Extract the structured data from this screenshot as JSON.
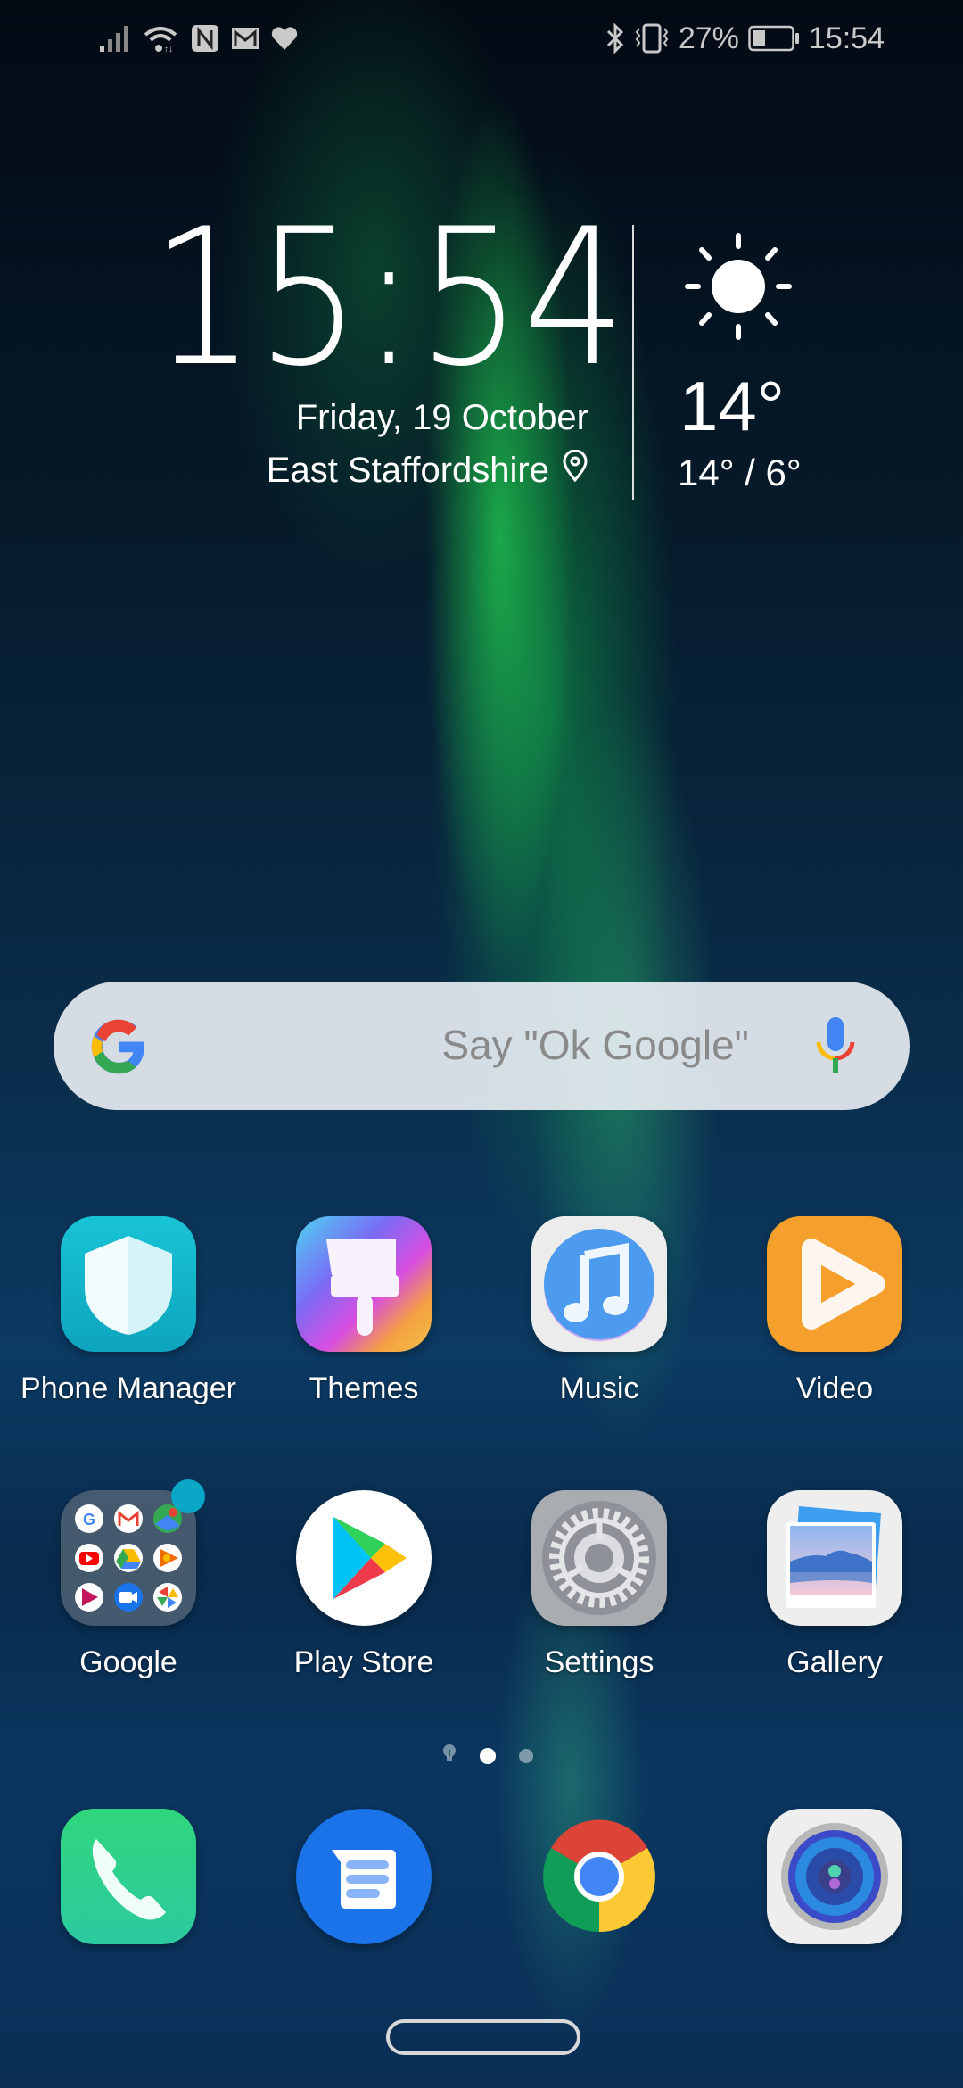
{
  "status_bar": {
    "left_icons": [
      "signal-icon",
      "wifi-icon",
      "nfc-icon",
      "gmail-icon",
      "health-icon"
    ],
    "right_icons": [
      "bluetooth-icon",
      "vibrate-icon"
    ],
    "battery_percent": "27%",
    "battery_level": 0.27,
    "time": "15:54"
  },
  "clock_widget": {
    "hours": "15",
    "minutes": "54",
    "date": "Friday, 19 October",
    "location": "East Staffordshire"
  },
  "weather_widget": {
    "condition_icon": "sun-icon",
    "temperature": "14°",
    "range": "14° / 6°"
  },
  "search_bar": {
    "hint": "Say \"Ok Google\"",
    "left_icon": "google-g-icon",
    "right_icon": "mic-icon"
  },
  "apps_row1": [
    {
      "label": "Phone Manager",
      "icon": "shield-icon"
    },
    {
      "label": "Themes",
      "icon": "paintbrush-icon"
    },
    {
      "label": "Music",
      "icon": "music-note-icon"
    },
    {
      "label": "Video",
      "icon": "play-icon"
    }
  ],
  "apps_row2": [
    {
      "label": "Google",
      "icon": "folder-icon",
      "badge": true
    },
    {
      "label": "Play Store",
      "icon": "play-store-icon"
    },
    {
      "label": "Settings",
      "icon": "gear-icon"
    },
    {
      "label": "Gallery",
      "icon": "gallery-icon"
    }
  ],
  "folder_contents": [
    "google-icon",
    "gmail-icon",
    "maps-icon",
    "youtube-icon",
    "drive-icon",
    "play-music-icon",
    "play-movies-icon",
    "duo-icon",
    "photos-icon"
  ],
  "page_indicator": {
    "pages": 3,
    "current": 2,
    "first_is_hint": true
  },
  "dock": [
    {
      "name": "phone",
      "icon": "phone-icon"
    },
    {
      "name": "messages",
      "icon": "messages-icon"
    },
    {
      "name": "chrome",
      "icon": "chrome-icon"
    },
    {
      "name": "camera",
      "icon": "camera-icon"
    }
  ],
  "colors": {
    "badge": "#0aa8c6",
    "phone_manager": "#12b6cc",
    "video": "#f5a02c",
    "phone": "#2fcf86",
    "messages": "#1a73e8"
  }
}
